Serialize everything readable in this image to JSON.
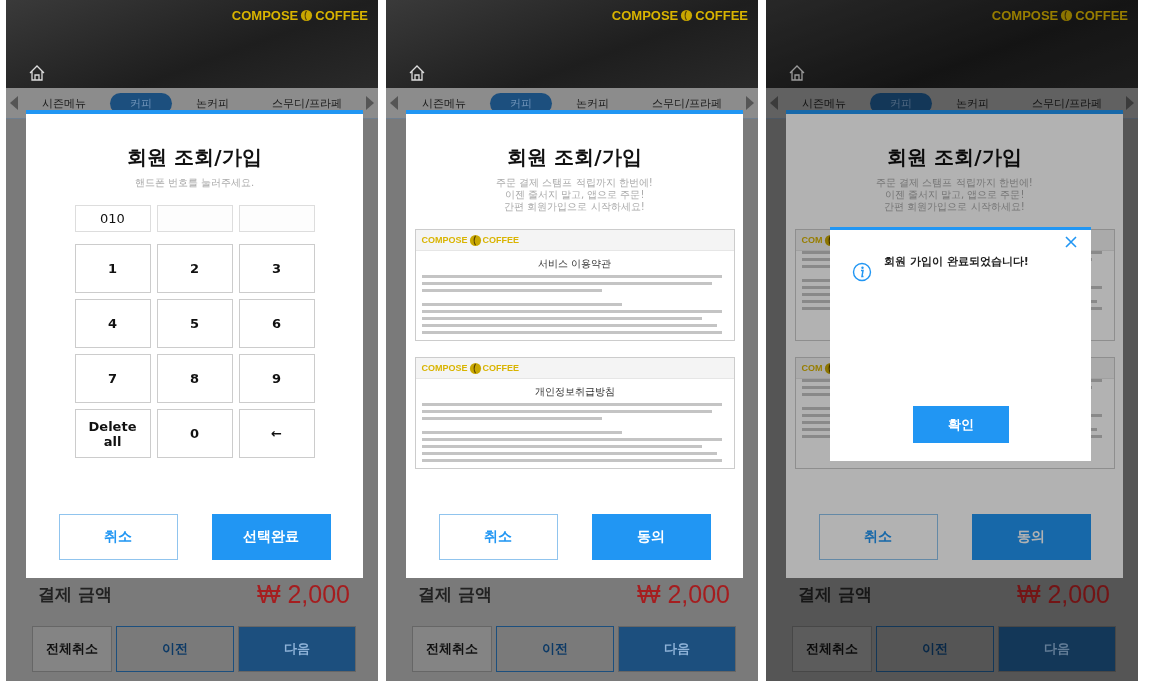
{
  "panels": [
    {
      "header": {
        "logo_left": "COMPOSE",
        "logo_right": "COFFEE"
      },
      "tabs": [
        {
          "label": "시즌메뉴",
          "selected": false
        },
        {
          "label": "커피",
          "selected": true
        },
        {
          "label": "논커피",
          "selected": false
        },
        {
          "label": "스무디/프라페",
          "selected": false
        }
      ],
      "summary": {
        "label": "결제 금액",
        "amount": "₩ 2,000"
      },
      "footer_buttons": [
        {
          "label": "전체취소",
          "kind": "plain"
        },
        {
          "label": "이전",
          "kind": "outline"
        },
        {
          "label": "다음",
          "kind": "primary"
        }
      ],
      "modal": {
        "kind": "keypad",
        "title": "회원 조회/가입",
        "subtitle": [
          "핸드폰 번호를 눌러주세요."
        ],
        "phone_fields": [
          {
            "kind": "filled",
            "value": "010"
          },
          {
            "kind": "empty"
          },
          {
            "kind": "empty"
          }
        ],
        "keys": [
          {
            "label": "1"
          },
          {
            "label": "2"
          },
          {
            "label": "3"
          },
          {
            "label": "4"
          },
          {
            "label": "5"
          },
          {
            "label": "6"
          },
          {
            "label": "7"
          },
          {
            "label": "8"
          },
          {
            "label": "9"
          },
          {
            "label": "Delete all"
          },
          {
            "label": "0"
          },
          {
            "label": "←"
          }
        ],
        "buttons": [
          {
            "label": "취소",
            "kind": "outline"
          },
          {
            "label": "선택완료",
            "kind": "primary"
          }
        ]
      }
    },
    {
      "header": {
        "logo_left": "COMPOSE",
        "logo_right": "COFFEE"
      },
      "tabs": [
        {
          "label": "시즌메뉴",
          "selected": false
        },
        {
          "label": "커피",
          "selected": true
        },
        {
          "label": "논커피",
          "selected": false
        },
        {
          "label": "스무디/프라페",
          "selected": false
        }
      ],
      "summary": {
        "label": "결제 금액",
        "amount": "₩ 2,000"
      },
      "footer_buttons": [
        {
          "label": "전체취소",
          "kind": "plain"
        },
        {
          "label": "이전",
          "kind": "outline"
        },
        {
          "label": "다음",
          "kind": "primary"
        }
      ],
      "modal": {
        "kind": "terms",
        "title": "회원 조회/가입",
        "subtitle": [
          "주문 결제 스탬프 적립까지 한번에!",
          "이젠 줄서지 말고, 앱으로 주문!",
          "간편 회원가입으로 시작하세요!"
        ],
        "documents": [
          {
            "logo_left": "COMPOSE",
            "logo_right": "COFFEE",
            "title": "서비스 이용약관"
          },
          {
            "logo_left": "COMPOSE",
            "logo_right": "COFFEE",
            "title": "개인정보취급방침"
          }
        ],
        "buttons": [
          {
            "label": "취소",
            "kind": "outline"
          },
          {
            "label": "동의",
            "kind": "primary"
          }
        ]
      }
    },
    {
      "header": {
        "logo_left": "COMPOSE",
        "logo_right": "COFFEE"
      },
      "tabs": [
        {
          "label": "시즌메뉴",
          "selected": false
        },
        {
          "label": "커피",
          "selected": true
        },
        {
          "label": "논커피",
          "selected": false
        },
        {
          "label": "스무디/프라페",
          "selected": false
        }
      ],
      "summary": {
        "label": "결제 금액",
        "amount": "₩ 2,000"
      },
      "footer_buttons": [
        {
          "label": "전체취소",
          "kind": "plain"
        },
        {
          "label": "이전",
          "kind": "outline"
        },
        {
          "label": "다음",
          "kind": "primary"
        }
      ],
      "modal": {
        "kind": "terms",
        "title": "회원 조회/가입",
        "subtitle": [
          "주문 결제 스탬프 적립까지 한번에!",
          "이젠 줄서지 말고, 앱으로 주문!",
          "간편 회원가입으로 시작하세요!"
        ],
        "documents": [
          {
            "logo_left": "COM"
          },
          {
            "logo_left": "COM"
          }
        ],
        "buttons": [
          {
            "label": "취소",
            "kind": "outline"
          },
          {
            "label": "동의",
            "kind": "primary"
          }
        ]
      },
      "alert": {
        "message": "회원 가입이 완료되었습니다!",
        "button": "확인"
      }
    }
  ]
}
